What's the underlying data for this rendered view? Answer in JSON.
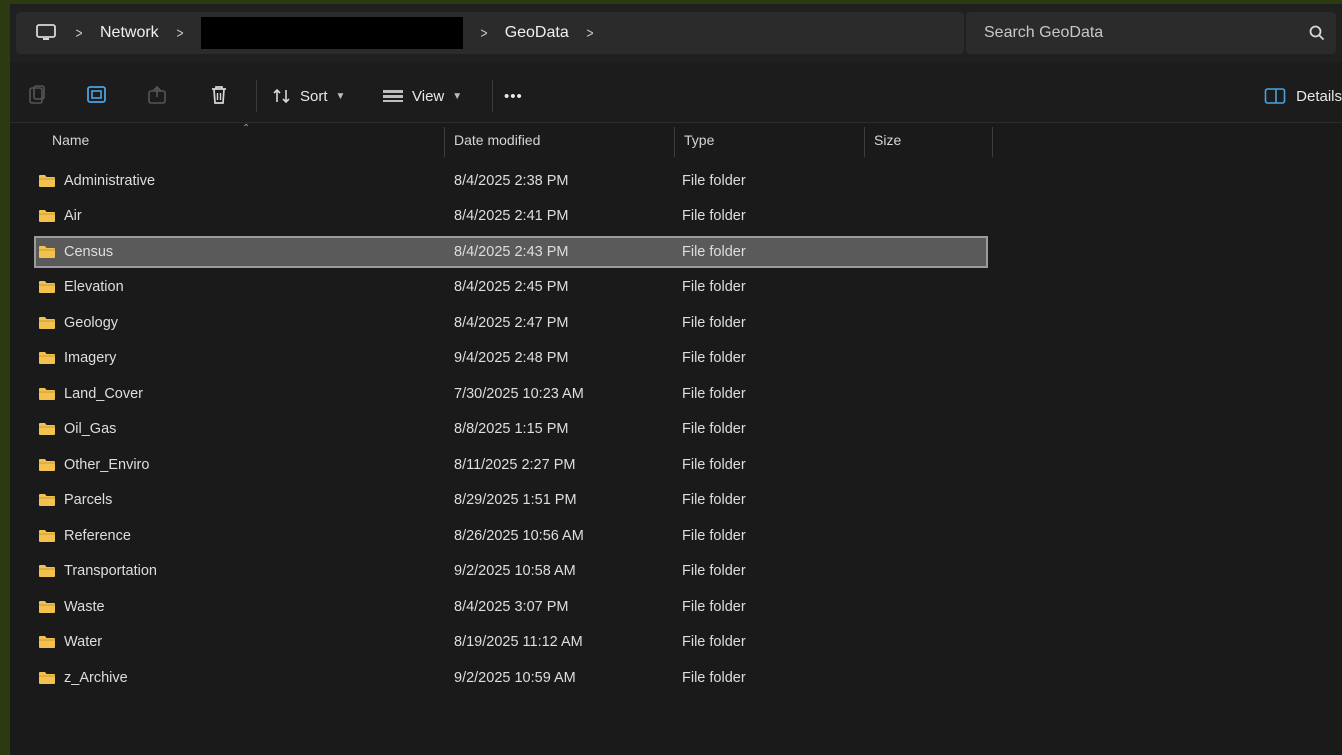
{
  "breadcrumb": {
    "items": [
      "Network",
      "GeoData"
    ]
  },
  "search": {
    "placeholder": "Search GeoData"
  },
  "toolbar": {
    "sort_label": "Sort",
    "view_label": "View",
    "more_label": "•••",
    "details_label": "Details"
  },
  "columns": {
    "name": "Name",
    "date": "Date modified",
    "type": "Type",
    "size": "Size"
  },
  "files": [
    {
      "name": "Administrative",
      "date": "8/4/2025 2:38 PM",
      "type": "File folder"
    },
    {
      "name": "Air",
      "date": "8/4/2025 2:41 PM",
      "type": "File folder"
    },
    {
      "name": "Census",
      "date": "8/4/2025 2:43 PM",
      "type": "File folder"
    },
    {
      "name": "Elevation",
      "date": "8/4/2025 2:45 PM",
      "type": "File folder"
    },
    {
      "name": "Geology",
      "date": "8/4/2025 2:47 PM",
      "type": "File folder"
    },
    {
      "name": "Imagery",
      "date": "9/4/2025 2:48 PM",
      "type": "File folder"
    },
    {
      "name": "Land_Cover",
      "date": "7/30/2025 10:23 AM",
      "type": "File folder"
    },
    {
      "name": "Oil_Gas",
      "date": "8/8/2025 1:15 PM",
      "type": "File folder"
    },
    {
      "name": "Other_Enviro",
      "date": "8/11/2025 2:27 PM",
      "type": "File folder"
    },
    {
      "name": "Parcels",
      "date": "8/29/2025 1:51 PM",
      "type": "File folder"
    },
    {
      "name": "Reference",
      "date": "8/26/2025 10:56 AM",
      "type": "File folder"
    },
    {
      "name": "Transportation",
      "date": "9/2/2025 10:58 AM",
      "type": "File folder"
    },
    {
      "name": "Waste",
      "date": "8/4/2025 3:07 PM",
      "type": "File folder"
    },
    {
      "name": "Water",
      "date": "8/19/2025 11:12 AM",
      "type": "File folder"
    },
    {
      "name": "z_Archive",
      "date": "9/2/2025 10:59 AM",
      "type": "File folder"
    }
  ],
  "selected_file": "Census",
  "colors": {
    "folder": "#f2c14e",
    "selection": "#5a5a5a",
    "background": "#1a1a1a"
  }
}
